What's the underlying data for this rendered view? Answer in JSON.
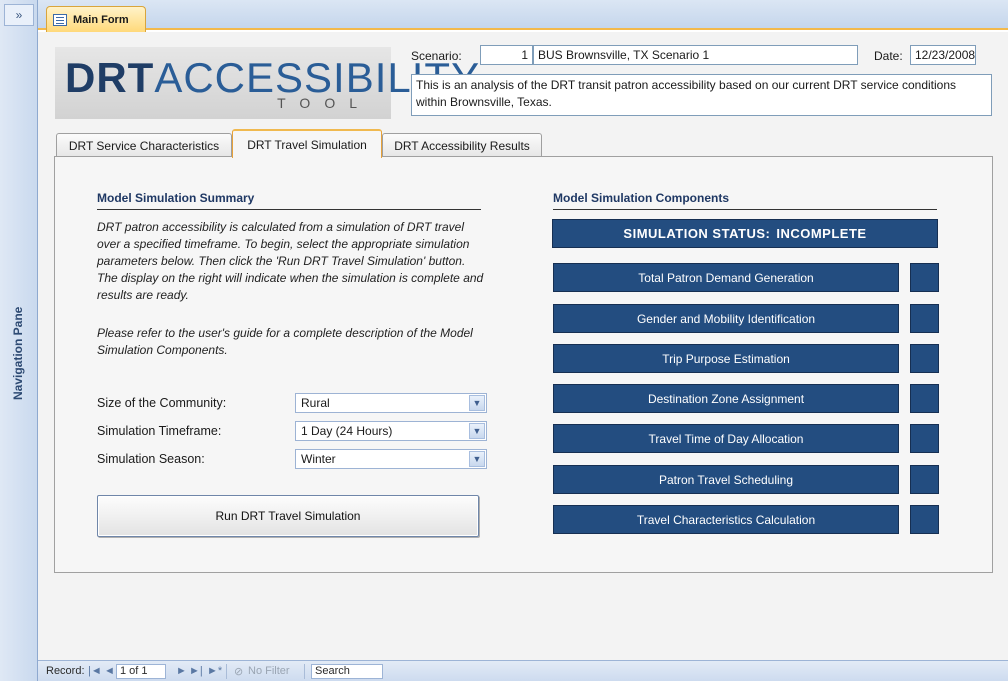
{
  "nav_pane": {
    "toggle": "»",
    "label": "Navigation Pane"
  },
  "doc_tab": {
    "label": "Main Form"
  },
  "logo": {
    "drt": "DRT",
    "accessibility": "ACCESSIBILITY",
    "tool": "TOOL"
  },
  "header": {
    "scenario_label": "Scenario:",
    "scenario_number": "1",
    "scenario_name": "BUS Brownsville, TX Scenario 1",
    "date_label": "Date:",
    "date_value": "12/23/2008",
    "description": "This is an analysis of the DRT transit patron accessibility based on our current DRT service conditions within Brownsville, Texas."
  },
  "tabs": [
    {
      "label": "DRT Service Characteristics"
    },
    {
      "label": "DRT Travel Simulation"
    },
    {
      "label": "DRT Accessibility Results"
    }
  ],
  "summary": {
    "title": "Model Simulation Summary",
    "para1": "DRT patron accessibility is calculated from a simulation of DRT travel over a specified timeframe.  To begin, select the appropriate simulation parameters below.  Then click the 'Run DRT Travel Simulation' button.  The display on the right will indicate when the simulation is complete and results are ready.",
    "para2": "Please refer to the user's guide for a complete description of the Model Simulation Components."
  },
  "params": {
    "community_label": "Size of the Community:",
    "community_value": "Rural",
    "timeframe_label": "Simulation Timeframe:",
    "timeframe_value": "1 Day (24 Hours)",
    "season_label": "Simulation Season:",
    "season_value": "Winter"
  },
  "run_button": "Run DRT Travel Simulation",
  "components": {
    "title": "Model Simulation Components",
    "status_prefix": "SIMULATION STATUS:",
    "status_value": "INCOMPLETE",
    "items": [
      {
        "label": "Total Patron Demand Generation"
      },
      {
        "label": "Gender and Mobility Identification"
      },
      {
        "label": "Trip Purpose Estimation"
      },
      {
        "label": "Destination Zone Assignment"
      },
      {
        "label": "Travel Time of Day Allocation"
      },
      {
        "label": "Patron Travel Scheduling"
      },
      {
        "label": "Travel Characteristics Calculation"
      }
    ]
  },
  "record_bar": {
    "record_label": "Record:",
    "first": "|◄",
    "prev": "◄",
    "position": "1 of 1",
    "next": "►",
    "last": "►|",
    "new": "►*",
    "filter": "No Filter",
    "search": "Search"
  },
  "colors": {
    "accent": "#234d80",
    "tab_highlight": "#f0b94f",
    "background": "#f3f3f3"
  }
}
